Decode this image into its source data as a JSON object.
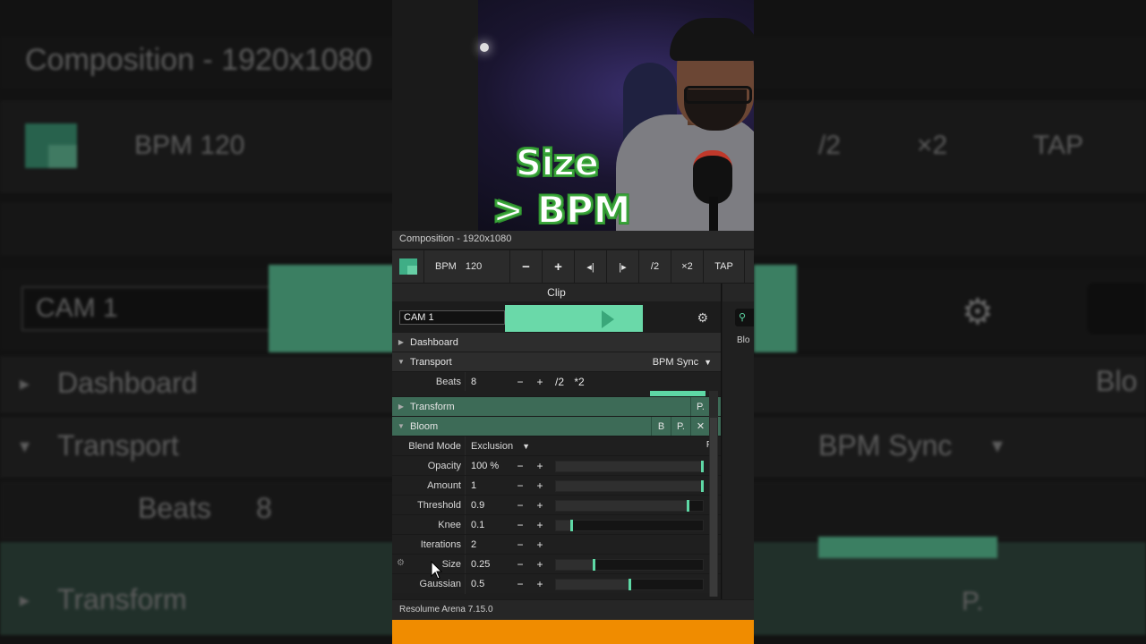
{
  "overlay": {
    "line1": "Size",
    "line2": "> BPM"
  },
  "app": {
    "composition_title": "Composition - 1920x1080",
    "status": "Resolume Arena 7.15.0"
  },
  "transport": {
    "bpm_label": "BPM",
    "bpm_value": "120",
    "buttons": [
      "−",
      "+",
      "◂|",
      "|▸",
      "/2",
      "×2",
      "TAP"
    ]
  },
  "clip": {
    "header": "Clip",
    "name": "CAM 1",
    "sections": {
      "dashboard": "Dashboard",
      "transport": "Transport",
      "transport_mode": "BPM Sync",
      "transform": "Transform",
      "bloom": "Bloom"
    },
    "beats": {
      "label": "Beats",
      "value": "8",
      "minus": "−",
      "plus": "+",
      "half": "/2",
      "double": "*2"
    },
    "bloom_buttons": {
      "b": "B",
      "p": "P.",
      "x": "✕"
    },
    "transform_p": "P.",
    "blend_mode": {
      "label": "Blend Mode",
      "value": "Exclusion",
      "p": "P."
    },
    "params": [
      {
        "label": "Opacity",
        "value": "100 %",
        "level": 1.0
      },
      {
        "label": "Amount",
        "value": "1",
        "level": 1.0
      },
      {
        "label": "Threshold",
        "value": "0.9",
        "level": 0.9
      },
      {
        "label": "Knee",
        "value": "0.1",
        "level": 0.1
      },
      {
        "label": "Iterations",
        "value": "2",
        "level": null
      },
      {
        "label": "Size",
        "value": "0.25",
        "level": 0.25
      },
      {
        "label": "Gaussian",
        "value": "0.5",
        "level": 0.5
      }
    ]
  },
  "right_panel": {
    "item": "Blo"
  },
  "background": {
    "title": "Composition - 1920x1080",
    "bpm": "BPM   120",
    "half": "/2",
    "double": "×2",
    "tap": "TAP",
    "cam": "CAM 1",
    "dashboard": "Dashboard",
    "transport": "Transport",
    "beats": "Beats",
    "beats_value": "8",
    "bpm_sync": "BPM Sync",
    "blo": "Blo",
    "transform": "Transform",
    "p": "P."
  }
}
